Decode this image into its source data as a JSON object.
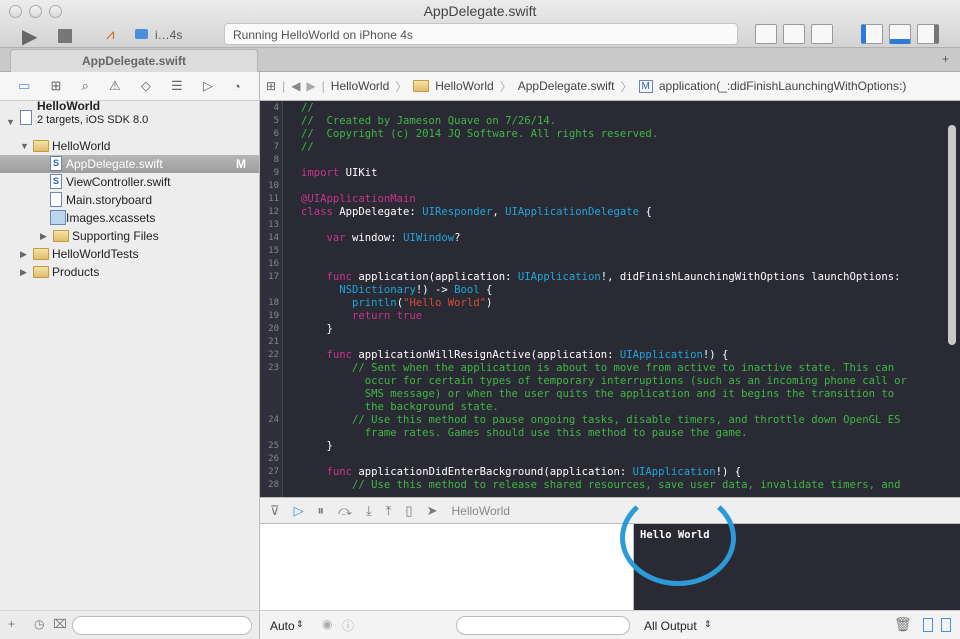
{
  "window": {
    "title": "AppDelegate.swift",
    "status": "Running HelloWorld on iPhone 4s",
    "scheme_device": "i…4s"
  },
  "tab": {
    "label": "AppDelegate.swift"
  },
  "navigator": {
    "project": {
      "name": "HelloWorld",
      "subtitle": "2 targets, iOS SDK 8.0"
    },
    "items": [
      {
        "label": "HelloWorld",
        "kind": "folder",
        "level": 1,
        "expanded": true
      },
      {
        "label": "AppDelegate.swift",
        "kind": "swift",
        "level": 2,
        "selected": true,
        "badge": "M"
      },
      {
        "label": "ViewController.swift",
        "kind": "swift",
        "level": 2
      },
      {
        "label": "Main.storyboard",
        "kind": "storyboard",
        "level": 2
      },
      {
        "label": "Images.xcassets",
        "kind": "assets",
        "level": 2
      },
      {
        "label": "Supporting Files",
        "kind": "folder",
        "level": 2,
        "expanded": false
      },
      {
        "label": "HelloWorldTests",
        "kind": "folder",
        "level": 1,
        "expanded": false
      },
      {
        "label": "Products",
        "kind": "folder",
        "level": 1,
        "expanded": false
      }
    ]
  },
  "jumpbar": [
    "HelloWorld",
    "HelloWorld",
    "AppDelegate.swift",
    "application(_:didFinishLaunchingWithOptions:)"
  ],
  "colors": {
    "comment": "#41b645",
    "keyword": "#c8358c",
    "type": "#20a6d9",
    "string": "#db4a34",
    "plain": "#ffffff",
    "accent": "#2d9ad8"
  },
  "code": [
    {
      "n": "4",
      "s": [
        [
          "c",
          "//"
        ]
      ]
    },
    {
      "n": "5",
      "s": [
        [
          "c",
          "//  Created by Jameson Quave on 7/26/14."
        ]
      ]
    },
    {
      "n": "6",
      "s": [
        [
          "c",
          "//  Copyright (c) 2014 JQ Software. All rights reserved."
        ]
      ]
    },
    {
      "n": "7",
      "s": [
        [
          "c",
          "//"
        ]
      ]
    },
    {
      "n": "8",
      "s": []
    },
    {
      "n": "9",
      "s": [
        [
          "k",
          "import"
        ],
        [
          "p",
          " UIKit"
        ]
      ]
    },
    {
      "n": "10",
      "s": []
    },
    {
      "n": "11",
      "s": [
        [
          "k",
          "@UIApplicationMain"
        ]
      ]
    },
    {
      "n": "12",
      "s": [
        [
          "k",
          "class"
        ],
        [
          "p",
          " AppDelegate: "
        ],
        [
          "t",
          "UIResponder"
        ],
        [
          "p",
          ", "
        ],
        [
          "t",
          "UIApplicationDelegate"
        ],
        [
          "p",
          " {"
        ]
      ]
    },
    {
      "n": "13",
      "s": []
    },
    {
      "n": "14",
      "s": [
        [
          "p",
          "    "
        ],
        [
          "k",
          "var"
        ],
        [
          "p",
          " window: "
        ],
        [
          "t",
          "UIWindow"
        ],
        [
          "p",
          "?"
        ]
      ]
    },
    {
      "n": "15",
      "s": []
    },
    {
      "n": "16",
      "s": []
    },
    {
      "n": "17",
      "s": [
        [
          "p",
          "    "
        ],
        [
          "k",
          "func"
        ],
        [
          "p",
          " application(application: "
        ],
        [
          "t",
          "UIApplication"
        ],
        [
          "p",
          "!, didFinishLaunchingWithOptions launchOptions:"
        ]
      ]
    },
    {
      "n": "",
      "s": [
        [
          "p",
          "      "
        ],
        [
          "t",
          "NSDictionary"
        ],
        [
          "p",
          "!) -> "
        ],
        [
          "t",
          "Bool"
        ],
        [
          "p",
          " {"
        ]
      ]
    },
    {
      "n": "18",
      "s": [
        [
          "p",
          "        "
        ],
        [
          "t",
          "println"
        ],
        [
          "p",
          "("
        ],
        [
          "s",
          "\"Hello World\""
        ],
        [
          "p",
          ")"
        ]
      ]
    },
    {
      "n": "19",
      "s": [
        [
          "p",
          "        "
        ],
        [
          "k",
          "return true"
        ]
      ]
    },
    {
      "n": "20",
      "s": [
        [
          "p",
          "    }"
        ]
      ]
    },
    {
      "n": "21",
      "s": []
    },
    {
      "n": "22",
      "s": [
        [
          "p",
          "    "
        ],
        [
          "k",
          "func"
        ],
        [
          "p",
          " applicationWillResignActive(application: "
        ],
        [
          "t",
          "UIApplication"
        ],
        [
          "p",
          "!) {"
        ]
      ]
    },
    {
      "n": "23",
      "s": [
        [
          "c",
          "        // Sent when the application is about to move from active to inactive state. This can"
        ]
      ]
    },
    {
      "n": "",
      "s": [
        [
          "c",
          "          occur for certain types of temporary interruptions (such as an incoming phone call or"
        ]
      ]
    },
    {
      "n": "",
      "s": [
        [
          "c",
          "          SMS message) or when the user quits the application and it begins the transition to"
        ]
      ]
    },
    {
      "n": "",
      "s": [
        [
          "c",
          "          the background state."
        ]
      ]
    },
    {
      "n": "24",
      "s": [
        [
          "c",
          "        // Use this method to pause ongoing tasks, disable timers, and throttle down OpenGL ES"
        ]
      ]
    },
    {
      "n": "",
      "s": [
        [
          "c",
          "          frame rates. Games should use this method to pause the game."
        ]
      ]
    },
    {
      "n": "25",
      "s": [
        [
          "p",
          "    }"
        ]
      ]
    },
    {
      "n": "26",
      "s": []
    },
    {
      "n": "27",
      "s": [
        [
          "p",
          "    "
        ],
        [
          "k",
          "func"
        ],
        [
          "p",
          " applicationDidEnterBackground(application: "
        ],
        [
          "t",
          "UIApplication"
        ],
        [
          "p",
          "!) {"
        ]
      ]
    },
    {
      "n": "28",
      "s": [
        [
          "c",
          "        // Use this method to release shared resources, save user data, invalidate timers, and"
        ]
      ]
    }
  ],
  "debug": {
    "target": "HelloWorld",
    "console_output": "Hello World",
    "vars_scope": "Auto",
    "console_scope": "All Output"
  }
}
